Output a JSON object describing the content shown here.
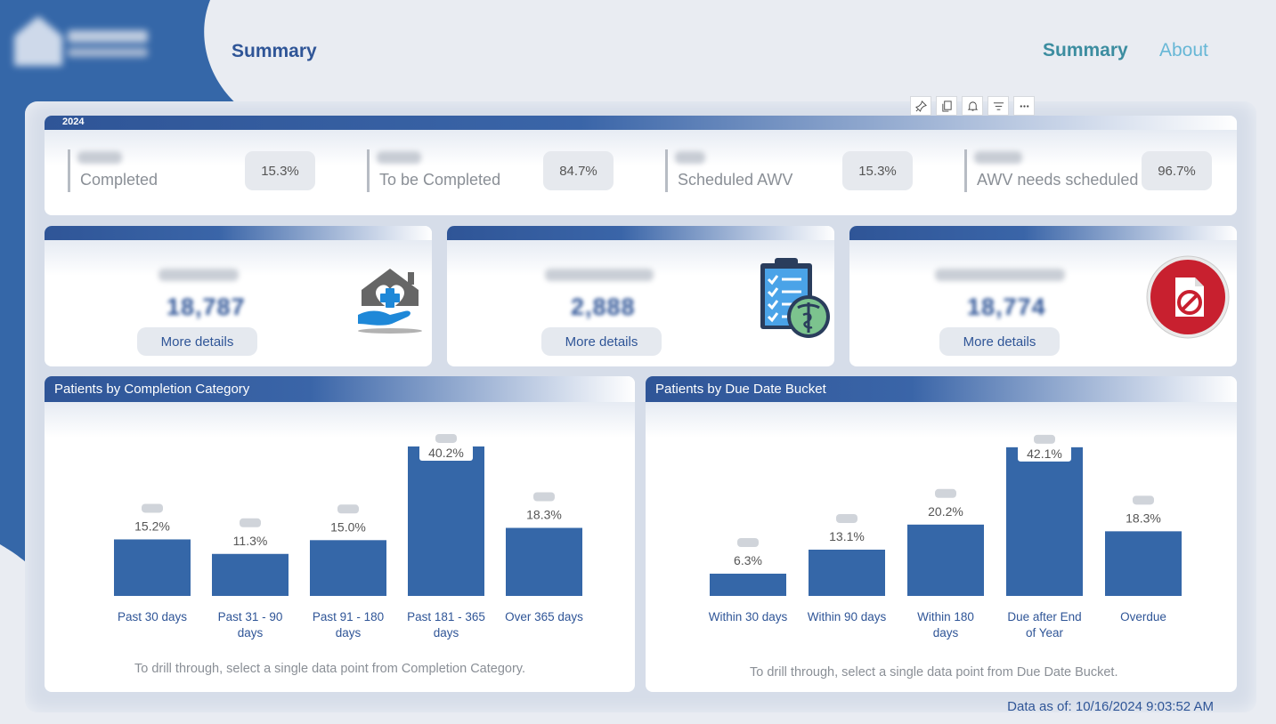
{
  "header": {
    "page_title": "Summary",
    "nav": [
      {
        "label": "Summary",
        "active": true
      },
      {
        "label": "About",
        "active": false
      }
    ]
  },
  "toolbar": {
    "icons": [
      "pin-icon",
      "copy-icon",
      "bell-icon",
      "filter-icon",
      "more-icon"
    ]
  },
  "kpi": {
    "year": "2024",
    "items": [
      {
        "label": "Completed",
        "percent": "15.3%"
      },
      {
        "label": "To be Completed",
        "percent": "84.7%"
      },
      {
        "label": "Scheduled AWV",
        "percent": "15.3%"
      },
      {
        "label": "AWV needs scheduled",
        "percent": "96.7%"
      }
    ]
  },
  "cards": [
    {
      "value": "18,787",
      "button": "More details",
      "icon": "health-care-hand-icon"
    },
    {
      "value": "2,888",
      "button": "More details",
      "icon": "medical-clipboard-icon"
    },
    {
      "value": "18,774",
      "button": "More details",
      "icon": "blocked-document-icon"
    }
  ],
  "charts": {
    "completion": {
      "title": "Patients by Completion Category",
      "note": "To drill through, select a single data point from Completion Category."
    },
    "due_date": {
      "title": "Patients by Due Date Bucket",
      "note": "To drill through, select a single data point from Due Date Bucket."
    }
  },
  "chart_data": [
    {
      "type": "bar",
      "title": "Patients by Completion Category",
      "categories": [
        "Past 30 days",
        "Past 31 - 90 days",
        "Past 91 - 180 days",
        "Past 181 - 365 days",
        "Over 365 days"
      ],
      "values": [
        15.2,
        11.3,
        15.0,
        40.2,
        18.3
      ],
      "labels": [
        "15.2%",
        "11.3%",
        "15.0%",
        "40.2%",
        "18.3%"
      ],
      "color": "#3567a8"
    },
    {
      "type": "bar",
      "title": "Patients by Due Date Bucket",
      "categories": [
        "Within 30 days",
        "Within 90 days",
        "Within 180 days",
        "Due after End of Year",
        "Overdue"
      ],
      "values": [
        6.3,
        13.1,
        20.2,
        42.1,
        18.3
      ],
      "labels": [
        "6.3%",
        "13.1%",
        "20.2%",
        "42.1%",
        "18.3%"
      ],
      "color": "#3567a8"
    }
  ],
  "footer": {
    "data_as_of": "Data as of: 10/16/2024 9:03:52 AM"
  },
  "colors": {
    "brand": "#2f5597",
    "bar": "#3567a8",
    "nav_active": "#3c8da0",
    "nav_inactive": "#67b7d6"
  }
}
